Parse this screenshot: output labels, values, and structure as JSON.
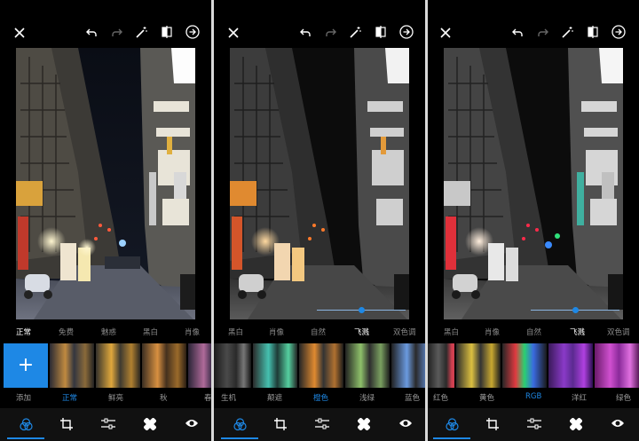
{
  "panels": [
    {
      "mode_tabs": [
        {
          "label": "正常",
          "selected": true
        },
        {
          "label": "免费",
          "selected": false
        },
        {
          "label": "魅惑",
          "selected": false
        },
        {
          "label": "黑白",
          "selected": false
        },
        {
          "label": "肖像",
          "selected": false
        }
      ],
      "add_label": "+",
      "filter_names": [
        {
          "label": "添加",
          "selected": false
        },
        {
          "label": "正常",
          "selected": true
        },
        {
          "label": "鲜亮",
          "selected": false
        },
        {
          "label": "秋",
          "selected": false
        },
        {
          "label": "春",
          "selected": false
        }
      ],
      "slider_value": null
    },
    {
      "mode_tabs": [
        {
          "label": "黑白",
          "selected": false
        },
        {
          "label": "肖像",
          "selected": false
        },
        {
          "label": "自然",
          "selected": false
        },
        {
          "label": "飞溅",
          "selected": true
        },
        {
          "label": "双色调",
          "selected": false
        }
      ],
      "filter_names": [
        {
          "label": "生机",
          "selected": false
        },
        {
          "label": "颠遮",
          "selected": false
        },
        {
          "label": "橙色",
          "selected": true
        },
        {
          "label": "浅绿",
          "selected": false
        },
        {
          "label": "蓝色",
          "selected": false
        }
      ],
      "slider_value": 0.5
    },
    {
      "mode_tabs": [
        {
          "label": "黑白",
          "selected": false
        },
        {
          "label": "肖像",
          "selected": false
        },
        {
          "label": "自然",
          "selected": false
        },
        {
          "label": "飞溅",
          "selected": true
        },
        {
          "label": "双色调",
          "selected": false
        }
      ],
      "filter_names": [
        {
          "label": "红色",
          "selected": false
        },
        {
          "label": "黄色",
          "selected": false
        },
        {
          "label": "RGB",
          "selected": true
        },
        {
          "label": "洋红",
          "selected": false
        },
        {
          "label": "绿色",
          "selected": false
        }
      ],
      "slider_value": 0.5
    }
  ],
  "icons": {
    "top": [
      "close-icon",
      "undo-icon",
      "redo-icon",
      "magic-wand-icon",
      "compare-icon",
      "next-icon"
    ],
    "bottom": [
      "filters-icon",
      "crop-icon",
      "adjust-icon",
      "healing-icon",
      "eye-icon"
    ]
  },
  "colors": {
    "accent": "#1e88e5",
    "background": "#000000"
  }
}
